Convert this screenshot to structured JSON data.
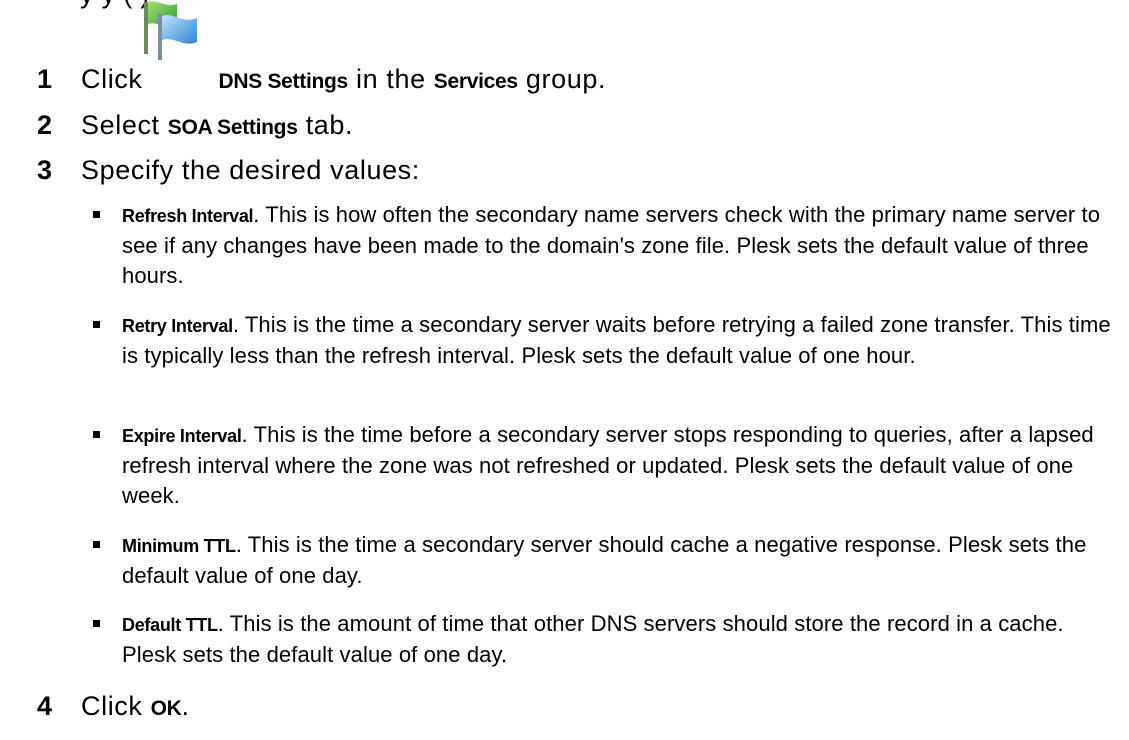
{
  "header_fragment": "y                                          y (     )",
  "steps": [
    {
      "num": "1",
      "pre": "Click",
      "bold": "DNS Settings",
      "mid": "in the",
      "bold2": "Services",
      "post": "group.",
      "icon": "flag-icon"
    },
    {
      "num": "2",
      "pre": "Select",
      "bold": "SOA Settings",
      "post": "tab."
    },
    {
      "num": "3",
      "text": "Specify the desired values:"
    },
    {
      "num": "4",
      "pre": "Click",
      "bold": "OK",
      "post": "."
    }
  ],
  "bullets": [
    {
      "term": "Refresh Interval",
      "text": ". This is how often the secondary name servers check with the primary name server to see if any changes have been made to the domain's zone file. Plesk sets the default value of three hours."
    },
    {
      "term": "Retry Interval",
      "text": ". This is the time a secondary server waits before retrying a failed zone transfer. This time is typically less than the refresh interval. Plesk sets the default value of one hour."
    },
    {
      "term": "Expire Interval",
      "text": ". This is the time before a secondary server stops responding to queries, after a lapsed refresh interval where the zone was not refreshed or updated. Plesk sets the default value of one week."
    },
    {
      "term": "Minimum TTL",
      "text": ". This is the time a secondary server should cache a negative response. Plesk sets the default value of one day."
    },
    {
      "term": "Default TTL",
      "text": ". This is the amount of time that other DNS servers should store the record in a cache. Plesk sets the default value of one day."
    }
  ],
  "colors": {
    "flag_green": "#3fb33a",
    "flag_blue": "#4aa3e0",
    "pole": "#7a8a99"
  }
}
